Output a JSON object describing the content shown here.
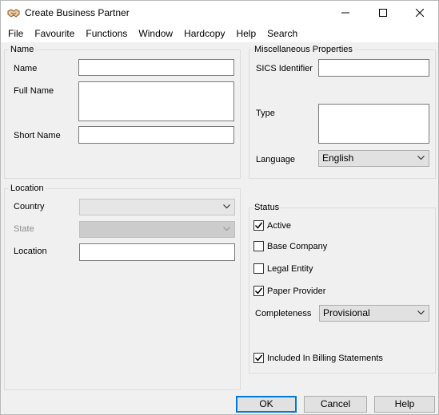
{
  "window": {
    "title": "Create Business Partner"
  },
  "menu": [
    "File",
    "Favourite",
    "Functions",
    "Window",
    "Hardcopy",
    "Help",
    "Search"
  ],
  "name_group": {
    "title": "Name",
    "name_label": "Name",
    "full_name_label": "Full Name",
    "short_name_label": "Short Name"
  },
  "misc_group": {
    "title": "Miscellaneous Properties",
    "sics_label": "SICS Identifier",
    "type_label": "Type",
    "language_label": "Language",
    "language_value": "English"
  },
  "location_group": {
    "title": "Location",
    "country_label": "Country",
    "state_label": "State",
    "location_label": "Location"
  },
  "status_group": {
    "title": "Status",
    "active_label": "Active",
    "active_checked": true,
    "base_company_label": "Base Company",
    "base_company_checked": false,
    "legal_entity_label": "Legal Entity",
    "legal_entity_checked": false,
    "paper_provider_label": "Paper Provider",
    "paper_provider_checked": true,
    "completeness_label": "Completeness",
    "completeness_value": "Provisional",
    "billing_label": "Included In Billing Statements",
    "billing_checked": true
  },
  "buttons": {
    "ok": "OK",
    "cancel": "Cancel",
    "help": "Help"
  },
  "colors": {
    "accent": "#0078d7",
    "disabled_text": "#8d8d8d"
  }
}
